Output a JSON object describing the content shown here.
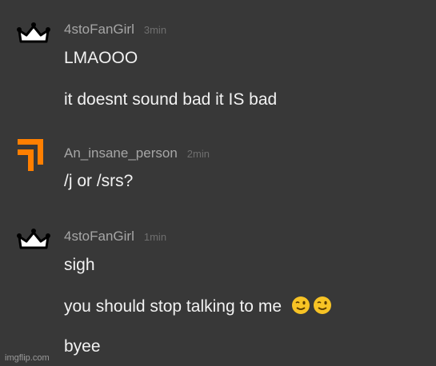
{
  "messages": [
    {
      "username": "4stoFanGirl",
      "time": "3min",
      "avatar_icon": "crown-icon",
      "lines": [
        "LMAOOO",
        "it doesnt sound bad it IS bad"
      ]
    },
    {
      "username": "An_insane_person",
      "time": "2min",
      "avatar_icon": "orange-corner-logo-icon",
      "lines": [
        "/j or /srs?"
      ]
    },
    {
      "username": "4stoFanGirl",
      "time": "1min",
      "avatar_icon": "crown-icon",
      "lines": [
        "sigh",
        "you should stop talking to me",
        "byee"
      ],
      "emojis": [
        "winking-face-icon",
        "winking-face-icon"
      ]
    }
  ],
  "watermark": "imgflip.com",
  "colors": {
    "background": "#383838",
    "username": "#a6a6a6",
    "timestamp": "#6f6f6f",
    "message_text": "#f2f2f2",
    "orange_avatar": "#ff7f00",
    "emoji": "#f7c325"
  }
}
